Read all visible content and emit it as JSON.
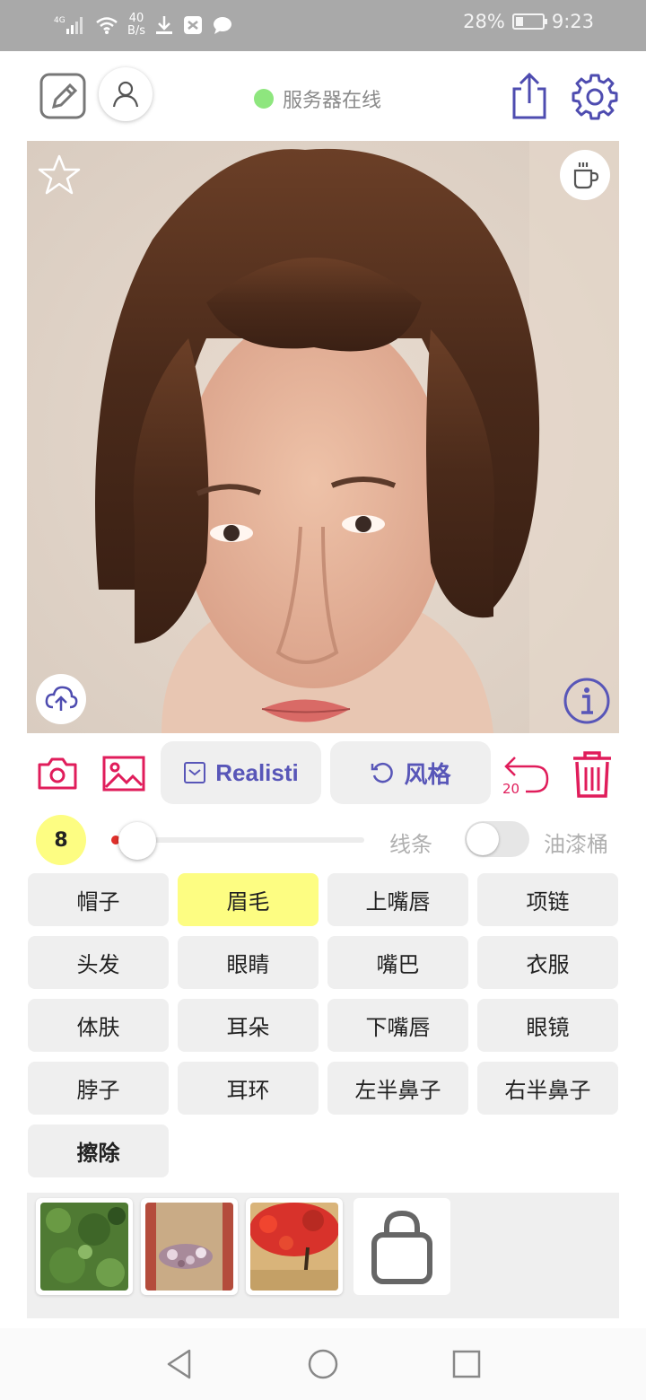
{
  "status_bar": {
    "network": "4G",
    "speed_value": "40",
    "speed_unit": "B/s",
    "battery": "28%",
    "battery_fraction": 0.28,
    "time": "9:23"
  },
  "header": {
    "server_status": "服务器在线"
  },
  "toolbar": {
    "mode_label": "Realisti",
    "style_label": "风格",
    "undo_count": "20"
  },
  "brush": {
    "size": "8",
    "slider_fraction": 0.05,
    "lines_label": "线条",
    "bucket_label": "油漆桶",
    "bucket_enabled": false
  },
  "parts": [
    {
      "label": "帽子",
      "active": false,
      "bold": false
    },
    {
      "label": "眉毛",
      "active": true,
      "bold": false
    },
    {
      "label": "上嘴唇",
      "active": false,
      "bold": false
    },
    {
      "label": "项链",
      "active": false,
      "bold": false
    },
    {
      "label": "头发",
      "active": false,
      "bold": false
    },
    {
      "label": "眼睛",
      "active": false,
      "bold": false
    },
    {
      "label": "嘴巴",
      "active": false,
      "bold": false
    },
    {
      "label": "衣服",
      "active": false,
      "bold": false
    },
    {
      "label": "体肤",
      "active": false,
      "bold": false
    },
    {
      "label": "耳朵",
      "active": false,
      "bold": false
    },
    {
      "label": "下嘴唇",
      "active": false,
      "bold": false
    },
    {
      "label": "眼镜",
      "active": false,
      "bold": false
    },
    {
      "label": "脖子",
      "active": false,
      "bold": false
    },
    {
      "label": "耳环",
      "active": false,
      "bold": false
    },
    {
      "label": "左半鼻子",
      "active": false,
      "bold": false
    },
    {
      "label": "右半鼻子",
      "active": false,
      "bold": false
    },
    {
      "label": "擦除",
      "active": false,
      "bold": true
    }
  ],
  "colors": {
    "accent_purple": "#5856b8",
    "accent_red": "#e01d5b",
    "highlight_yellow": "#fdfd82",
    "online_green": "#8ee67e"
  }
}
